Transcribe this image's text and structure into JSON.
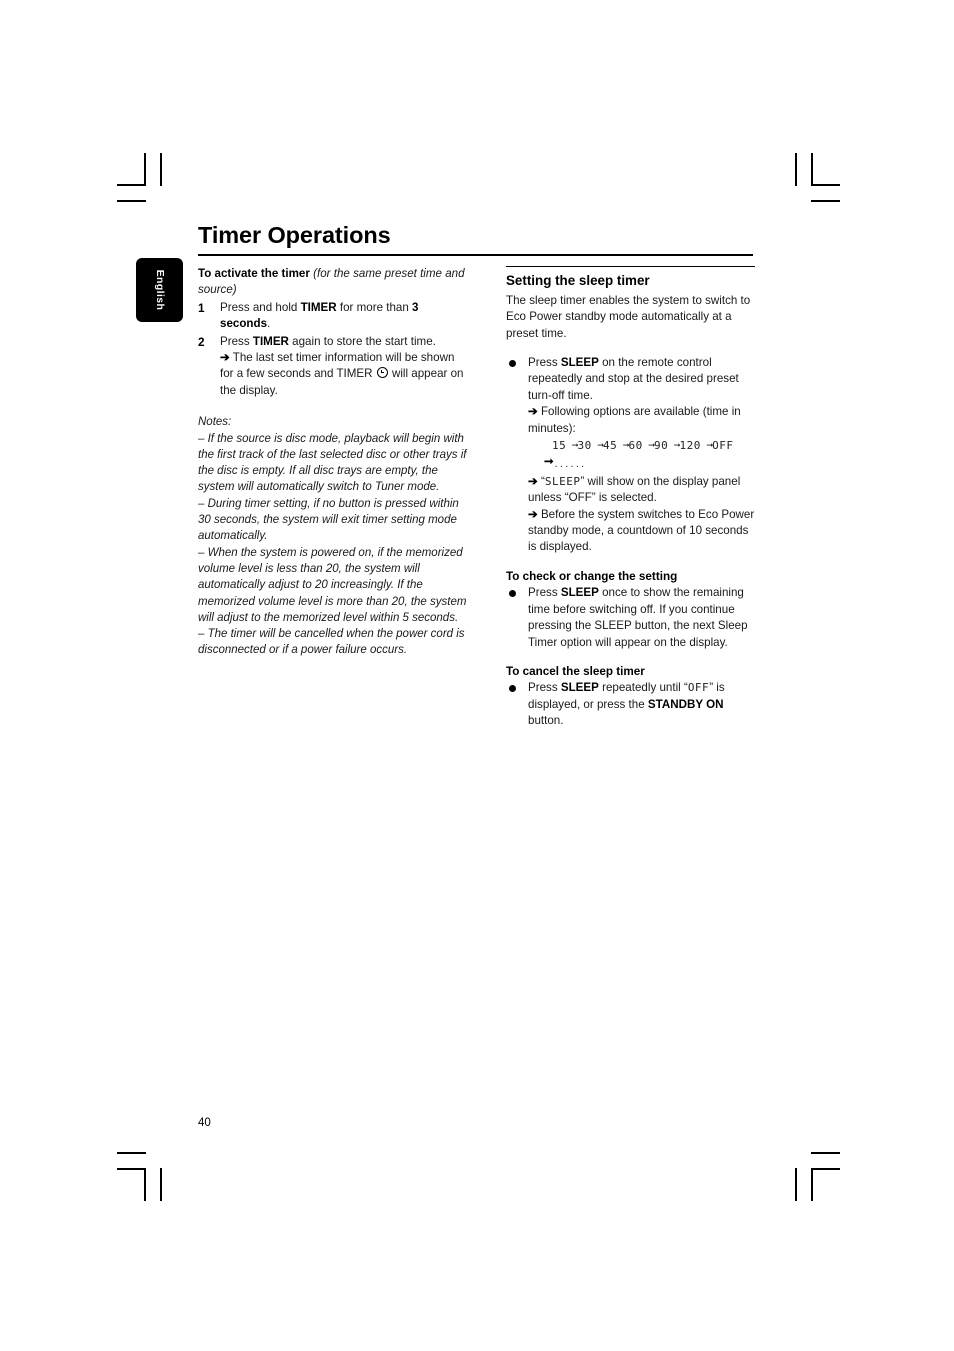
{
  "page": {
    "title": "Timer Operations",
    "number": "40",
    "language_tab": "English"
  },
  "left_column": {
    "intro": {
      "bold": "To activate the timer",
      "italic": "(for the same preset time and source)"
    },
    "steps": [
      {
        "num": "1",
        "text_before": "Press and hold ",
        "bold1": "TIMER",
        "text_mid": " for more than ",
        "bold2": "3 seconds",
        "text_after": "."
      },
      {
        "num": "2",
        "text_before": "Press ",
        "bold1": "TIMER",
        "text_mid": " again to store the start time.",
        "arrow_text_a": "The last set timer information will be shown for a few seconds and TIMER ",
        "arrow_text_b": " will appear on the display."
      }
    ],
    "notes_label": "Notes:",
    "notes": [
      "–  If the source is disc mode,  playback will begin with the first track of the last selected disc or other trays if the disc is empty. If all disc trays are empty, the system will automatically switch to Tuner mode.",
      "–  During timer setting, if no button is pressed within 30 seconds, the system will exit timer setting mode automatically.",
      "–  When the system is powered on, if the memorized volume level is less than 20, the system will automatically adjust to 20 increasingly. If the memorized volume level is more than 20, the system will adjust to the memorized level within 5 seconds.",
      "–  The timer will be cancelled when the power cord is disconnected or if a power failure occurs."
    ]
  },
  "right_column": {
    "section_heading": "Setting the sleep timer",
    "intro": "The sleep timer enables the system to switch to Eco Power standby mode automatically at a preset time.",
    "bullet1": {
      "text_before": "Press ",
      "bold": "SLEEP",
      "text_after": " on the remote control repeatedly and stop at the desired preset turn-off time.",
      "arrow1": "Following options are available (time in minutes):",
      "sequence": [
        "15",
        "30",
        "45",
        "60",
        "90",
        "120",
        "OFF"
      ],
      "sequence_separator": "➞",
      "sequence_continuation": "......",
      "arrow2_a": "“",
      "arrow2_lcd": "SLEEP",
      "arrow2_b": "” will show on the display panel unless “OFF” is selected.",
      "arrow3": "Before the system switches to Eco Power standby mode, a countdown of 10 seconds is displayed."
    },
    "check_heading": "To check or change the setting",
    "check_bullet": {
      "text_before": "Press ",
      "bold": "SLEEP",
      "text_after": " once to show the remaining time before switching off. If you continue pressing the SLEEP button, the next Sleep Timer option will appear on the display."
    },
    "cancel_heading": "To cancel the sleep timer",
    "cancel_bullet": {
      "text_before": "Press ",
      "bold1": "SLEEP",
      "text_mid_a": " repeatedly until “",
      "lcd_off": "OFF",
      "text_mid_b": "” is displayed, or press the ",
      "bold2": "STANDBY ON",
      "text_after": "  button."
    }
  },
  "colors": {
    "ink": "#000000",
    "body_text": "#1a1a1a",
    "paper": "#ffffff"
  }
}
